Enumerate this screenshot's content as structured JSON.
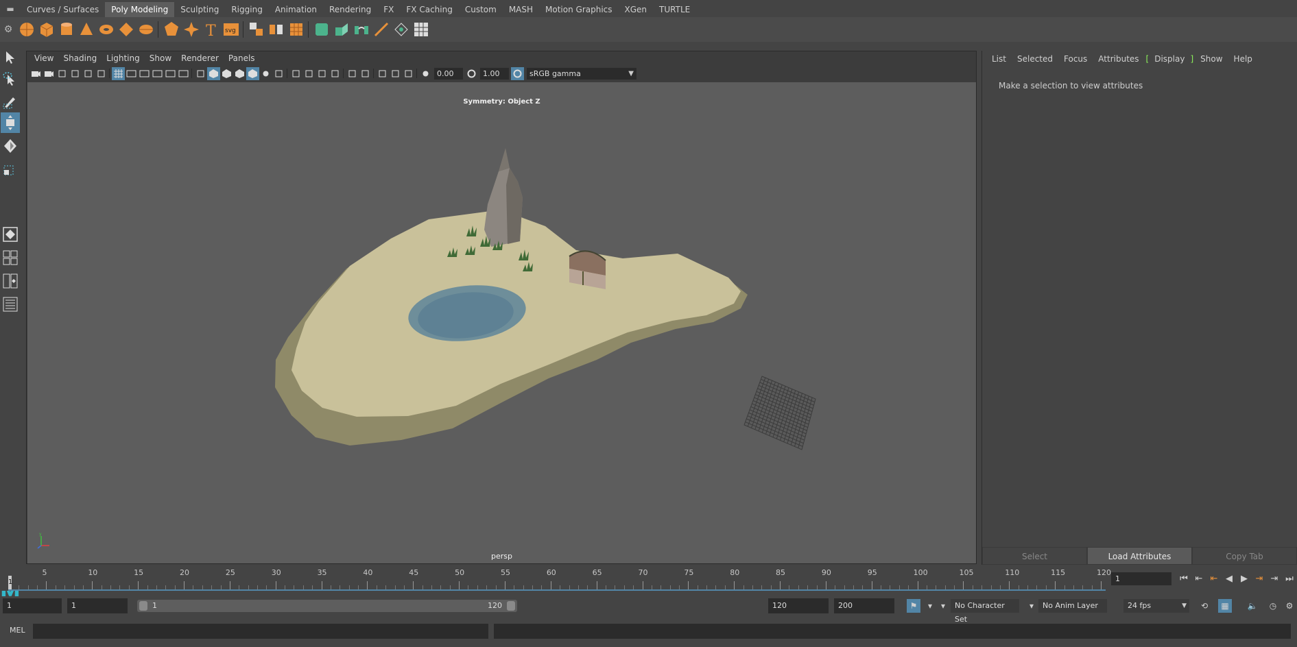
{
  "shelf_tabs": [
    "Curves / Surfaces",
    "Poly Modeling",
    "Sculpting",
    "Rigging",
    "Animation",
    "Rendering",
    "FX",
    "FX Caching",
    "Custom",
    "MASH",
    "Motion Graphics",
    "XGen",
    "TURTLE"
  ],
  "active_shelf_tab": "Poly Modeling",
  "shelf_icons": [
    "poly-sphere-icon",
    "poly-cube-icon",
    "poly-cylinder-icon",
    "poly-cone-icon",
    "poly-torus-icon",
    "poly-plane-icon",
    "poly-disc-icon",
    "platonic-solid-icon",
    "super-shape-icon",
    "type-tool-icon",
    "svg-tool-icon",
    "combine-icon",
    "separate-icon",
    "smooth-icon",
    "bevel-icon",
    "extrude-icon",
    "bridge-icon",
    "multi-cut-icon",
    "target-weld-icon",
    "uv-editor-icon"
  ],
  "colors": {
    "accent": "#5285a6",
    "highlight_green": "#8cf25a",
    "shelf_orange": "#e8913a",
    "shelf_green": "#4cb38c",
    "viewport_bg": "#5d5d5d",
    "sand": "#c9c19a",
    "water": "#6e8e9a",
    "maya_logo": "#34b7c9"
  },
  "viewport_menu": [
    "View",
    "Shading",
    "Lighting",
    "Show",
    "Renderer",
    "Panels"
  ],
  "viewport_toolbar": {
    "exposure": "0.00",
    "gamma_value": "1.00",
    "color_space": "sRGB gamma"
  },
  "viewport": {
    "symmetry_label": "Symmetry: Object Z",
    "camera": "persp"
  },
  "attribute_editor": {
    "menu": [
      "List",
      "Selected",
      "Focus",
      "Attributes"
    ],
    "display_tab": "Display",
    "menu_after": [
      "Show",
      "Help"
    ],
    "message": "Make a selection to view attributes",
    "buttons": [
      "Select",
      "Load Attributes",
      "Copy Tab"
    ]
  },
  "timeslider": {
    "labels": [
      "5",
      "10",
      "15",
      "20",
      "25",
      "30",
      "35",
      "40",
      "45",
      "50",
      "55",
      "60",
      "65",
      "70",
      "75",
      "80",
      "85",
      "90",
      "95",
      "100",
      "105",
      "110",
      "115",
      "120"
    ],
    "current_frame": "1",
    "frame_field": "1"
  },
  "range": {
    "start_frame": "1",
    "playback_start": "1",
    "range_start_label": "1",
    "range_end_label": "120",
    "playback_end": "120",
    "end_frame": "200",
    "character_set": "No Character Set",
    "anim_layer": "No Anim Layer",
    "fps": "24 fps"
  },
  "command_line": {
    "language": "MEL"
  }
}
